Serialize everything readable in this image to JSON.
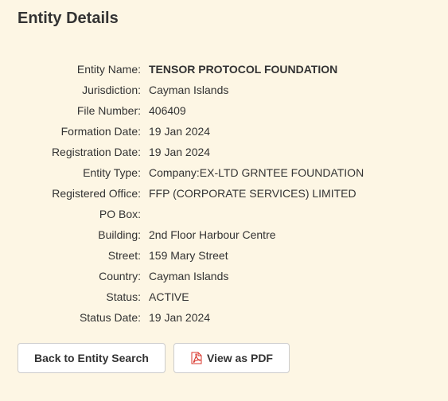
{
  "page": {
    "title": "Entity Details"
  },
  "details": [
    {
      "label": "Entity Name:",
      "value": "TENSOR PROTOCOL FOUNDATION",
      "emphasis": true
    },
    {
      "label": "Jurisdiction:",
      "value": "Cayman Islands"
    },
    {
      "label": "File Number:",
      "value": "406409"
    },
    {
      "label": "Formation Date:",
      "value": "19 Jan 2024"
    },
    {
      "label": "Registration Date:",
      "value": "19 Jan 2024"
    },
    {
      "label": "Entity Type:",
      "value": "Company:EX-LTD GRNTEE FOUNDATION"
    },
    {
      "label": "Registered Office:",
      "value": "FFP (CORPORATE SERVICES) LIMITED"
    },
    {
      "label": "PO Box:",
      "value": ""
    },
    {
      "label": "Building:",
      "value": "2nd Floor Harbour Centre"
    },
    {
      "label": "Street:",
      "value": "159 Mary Street"
    },
    {
      "label": "Country:",
      "value": "Cayman Islands"
    },
    {
      "label": "Status:",
      "value": "ACTIVE"
    },
    {
      "label": "Status Date:",
      "value": "19 Jan 2024"
    }
  ],
  "actions": {
    "back_label": "Back to Entity Search",
    "pdf_label": "View as PDF",
    "pdf_icon": "pdf-icon"
  },
  "colors": {
    "background": "#fdf6e4",
    "text": "#333333",
    "button_border": "#cccccc",
    "pdf_icon": "#d9342b"
  }
}
